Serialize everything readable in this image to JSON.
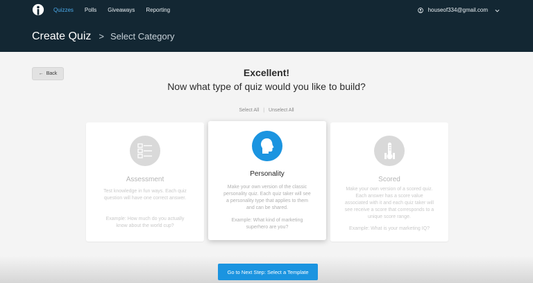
{
  "nav": {
    "items": [
      {
        "label": "Quizzes",
        "active": true
      },
      {
        "label": "Polls",
        "active": false
      },
      {
        "label": "Giveaways",
        "active": false
      },
      {
        "label": "Reporting",
        "active": false
      }
    ],
    "account_email": "houseof334@gmail.com"
  },
  "breadcrumb": {
    "title": "Create Quiz",
    "separator": ">",
    "current": "Select Category"
  },
  "back_label": "Back",
  "heading": {
    "line1": "Excellent!",
    "line2": "Now what type of quiz would you like to build?"
  },
  "selection": {
    "select_all": "Select All",
    "divider": "|",
    "unselect_all": "Unselect All"
  },
  "cards": [
    {
      "title": "Assessment",
      "description": "Test knowledge in fun ways. Each quiz question will have one correct answer.",
      "example": "Example: How much do you actually know about the world cup?",
      "selected": false,
      "icon": "checklist-icon"
    },
    {
      "title": "Personality",
      "description": "Make your own version of the classic personality quiz. Each quiz taker will see a personality type that applies to them and can be shared.",
      "example": "Example: What kind of marketing superhero are you?",
      "selected": true,
      "icon": "head-profile-icon"
    },
    {
      "title": "Scored",
      "description": "Make your own version of a scored quiz. Each answer has a score value associated with it and each quiz taker will see receive a score that corresponds to a unique score range.",
      "example": "Example: What is your marketing IQ?",
      "selected": false,
      "icon": "thermometer-icon"
    }
  ],
  "next_button": "Go to Next Step: Select a Template",
  "colors": {
    "header_bg": "#132733",
    "accent": "#1b94e0",
    "active_nav": "#4aa9e9"
  }
}
